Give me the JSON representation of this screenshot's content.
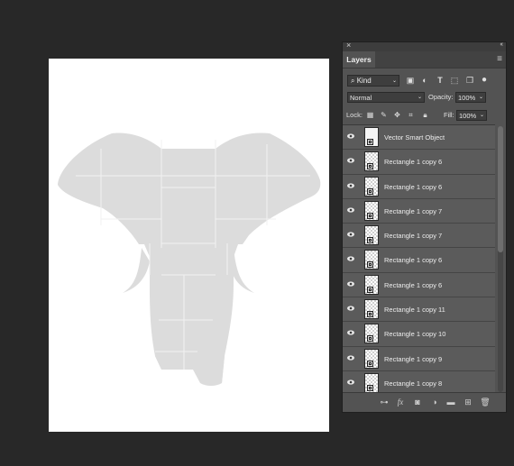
{
  "canvas": {
    "artwork_color": "#dcdcdc",
    "line_color": "#f2f2f2"
  },
  "panel": {
    "close_glyph": "×",
    "collapse_glyph": "‹‹",
    "tab_label": "Layers",
    "menu_glyph": "≡",
    "filter": {
      "search_glyph": "⌕",
      "kind_label": "Kind",
      "kind_arrow": "⌄",
      "icons": [
        "image-filter-icon",
        "adjustment-filter-icon",
        "type-filter-icon",
        "shape-filter-icon",
        "smart-object-filter-icon",
        "filter-toggle-icon"
      ]
    },
    "blend": {
      "mode": "Normal",
      "opacity_label": "Opacity:",
      "opacity_value": "100%"
    },
    "lock": {
      "label": "Lock:",
      "icons": [
        "lock-transparent-pixels-icon",
        "lock-image-pixels-icon",
        "lock-position-icon",
        "lock-artboard-icon",
        "lock-all-icon"
      ],
      "fill_label": "Fill:",
      "fill_value": "100%"
    },
    "layers": [
      {
        "name": "Vector Smart Object",
        "kind": "smart-object"
      },
      {
        "name": "Rectangle 1 copy 6",
        "kind": "smart-object"
      },
      {
        "name": "Rectangle 1 copy 6",
        "kind": "smart-object"
      },
      {
        "name": "Rectangle 1 copy 7",
        "kind": "smart-object"
      },
      {
        "name": "Rectangle 1 copy 7",
        "kind": "smart-object"
      },
      {
        "name": "Rectangle 1 copy 6",
        "kind": "smart-object"
      },
      {
        "name": "Rectangle 1 copy 6",
        "kind": "smart-object"
      },
      {
        "name": "Rectangle 1 copy 11",
        "kind": "smart-object"
      },
      {
        "name": "Rectangle 1 copy 10",
        "kind": "smart-object"
      },
      {
        "name": "Rectangle 1 copy 9",
        "kind": "smart-object"
      },
      {
        "name": "Rectangle 1 copy 8",
        "kind": "smart-object"
      }
    ],
    "bottom_icons": [
      "link-layers-icon",
      "fx-icon",
      "add-mask-icon",
      "adjustment-layer-icon",
      "new-group-icon",
      "new-layer-icon",
      "trash-icon"
    ]
  }
}
